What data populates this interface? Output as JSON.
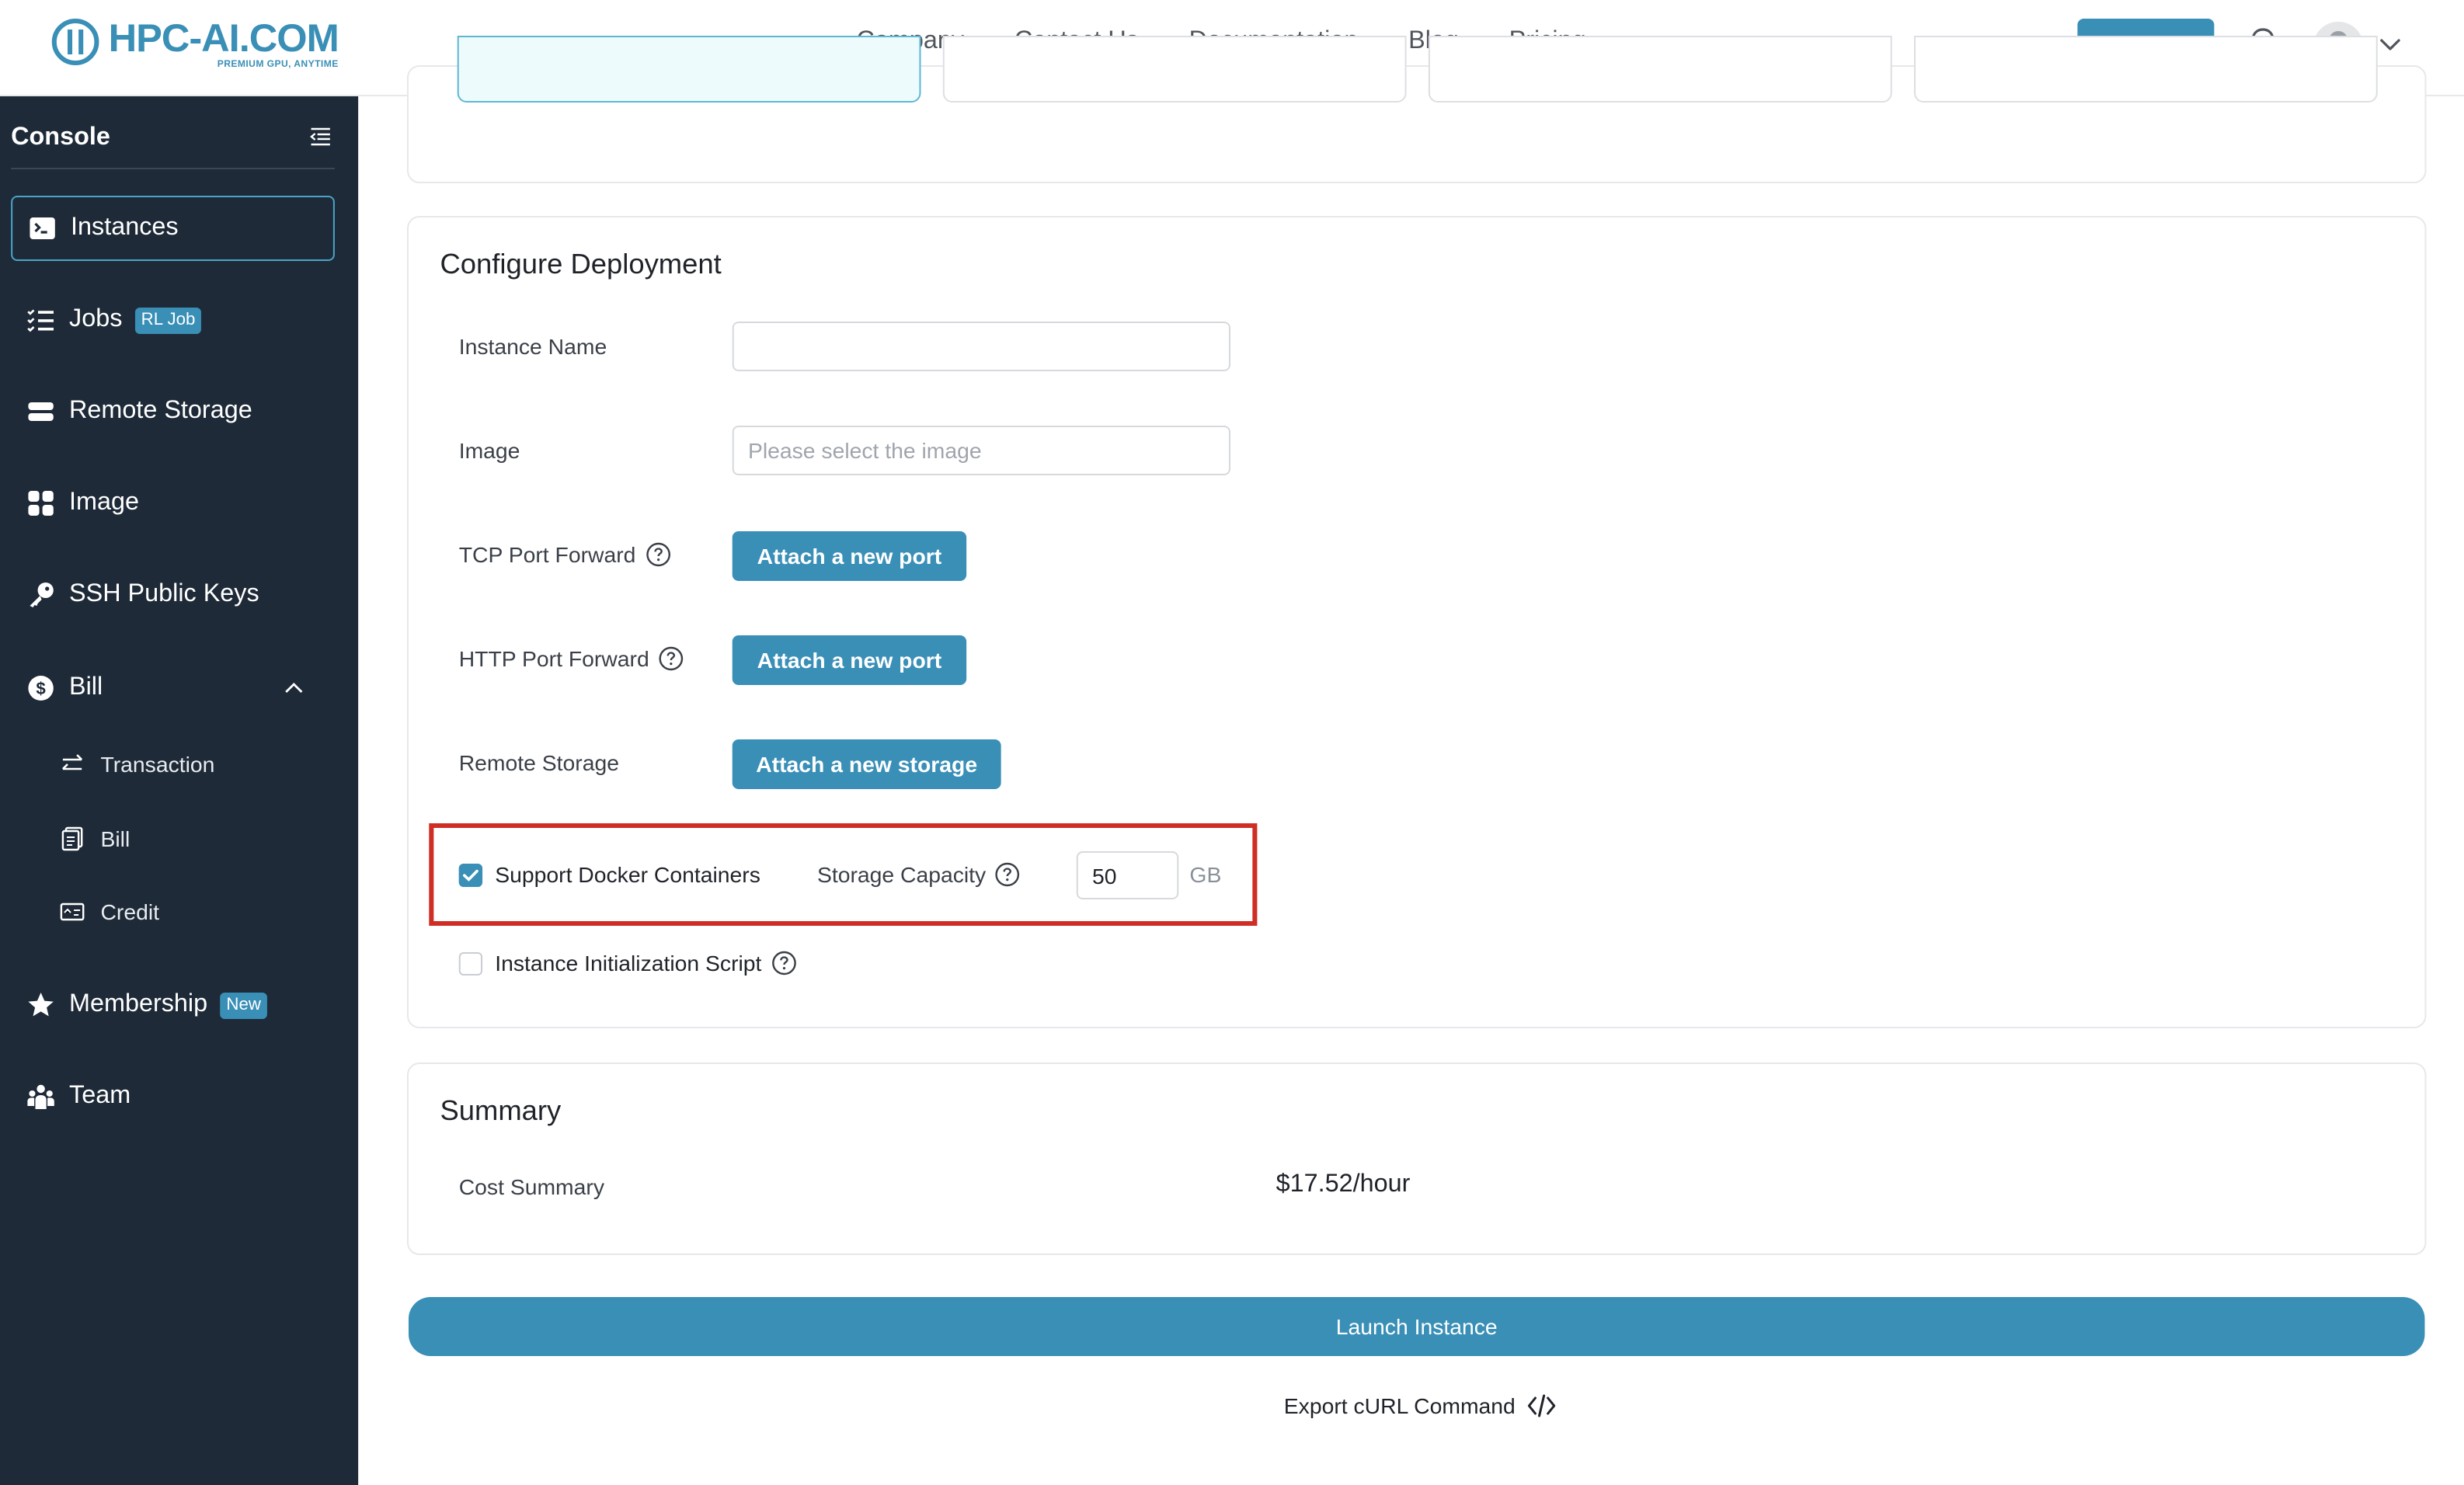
{
  "header": {
    "logo_text": "HPC-AI.COM",
    "logo_tagline": "PREMIUM GPU, ANYTIME",
    "nav": [
      "Company",
      "Contact Us",
      "Documentation",
      "Blog",
      "Pricing"
    ],
    "console_label": "Console"
  },
  "sidebar": {
    "title": "Console",
    "items": {
      "instances": "Instances",
      "jobs": "Jobs",
      "jobs_badge": "RL Job",
      "remote_storage": "Remote Storage",
      "image": "Image",
      "ssh_keys": "SSH Public Keys",
      "bill": "Bill",
      "transaction": "Transaction",
      "bill_sub": "Bill",
      "credit": "Credit",
      "membership": "Membership",
      "membership_badge": "New",
      "team": "Team"
    }
  },
  "configure": {
    "title": "Configure Deployment",
    "instance_name_label": "Instance Name",
    "instance_name_value": "",
    "image_label": "Image",
    "image_placeholder": "Please select the image",
    "tcp_label": "TCP Port Forward",
    "tcp_button": "Attach a new port",
    "http_label": "HTTP Port Forward",
    "http_button": "Attach a new port",
    "storage_label": "Remote Storage",
    "storage_button": "Attach a new storage",
    "docker_label": "Support Docker Containers",
    "docker_checked": true,
    "capacity_label": "Storage Capacity",
    "capacity_value": "50",
    "capacity_unit": "GB",
    "init_script_label": "Instance Initialization Script",
    "init_script_checked": false
  },
  "summary": {
    "title": "Summary",
    "cost_label": "Cost Summary",
    "cost_value": "$17.52/hour"
  },
  "actions": {
    "launch": "Launch Instance",
    "export": "Export cURL Command"
  },
  "colors": {
    "accent": "#3a8fb7",
    "sidebar_bg": "#1e2a38",
    "highlight": "#cf2e25"
  }
}
